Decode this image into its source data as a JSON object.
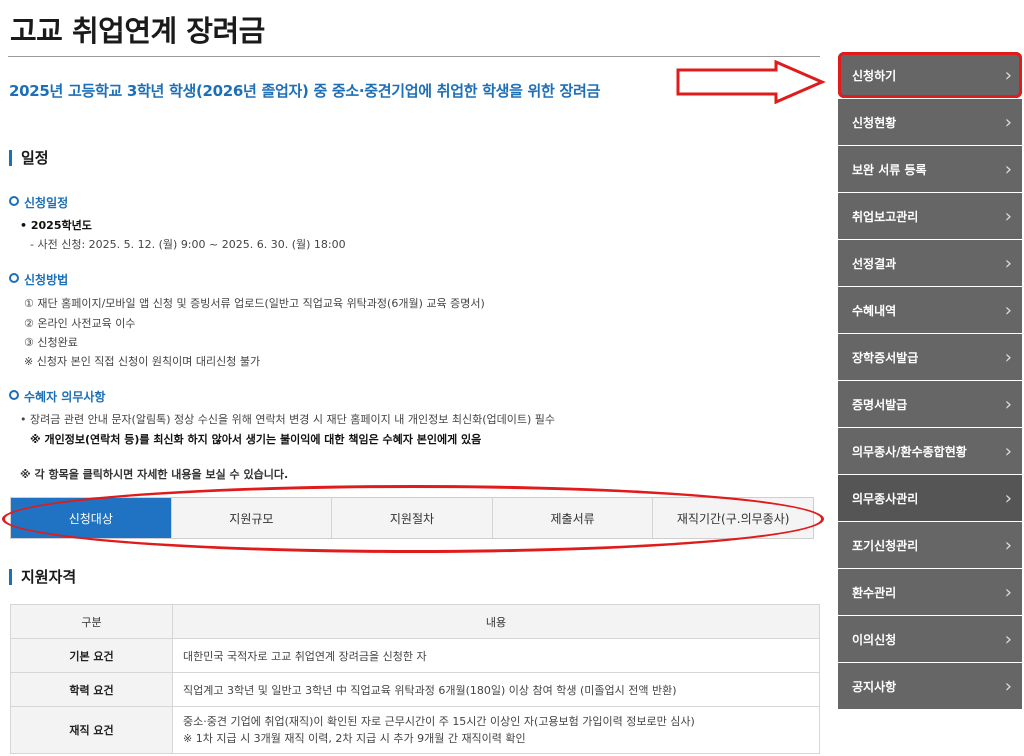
{
  "page": {
    "title": "고교 취업연계 장려금",
    "subtitle": "2025년 고등학교 3학년 학생(2026년 졸업자) 중 중소·중견기업에 취업한 학생을 위한 장려금"
  },
  "schedule": {
    "title": "일정",
    "apply_schedule": {
      "heading": "신청일정",
      "year": "• 2025학년도",
      "detail": "- 사전 신청: 2025. 5. 12. (월) 9:00 ~ 2025. 6. 30. (월) 18:00"
    },
    "apply_method": {
      "heading": "신청방법",
      "steps": [
        "① 재단 홈페이지/모바일 앱 신청 및 증빙서류 업로드(일반고 직업교육 위탁과정(6개월) 교육 증명서)",
        "② 온라인 사전교육 이수",
        "③ 신청완료"
      ],
      "note": "※ 신청자 본인 직접 신청이 원칙이며 대리신청 불가"
    },
    "obligations": {
      "heading": "수혜자 의무사항",
      "item": "• 장려금 관련 안내 문자(알림톡) 정상 수신을 위해 연락처 변경 시 재단 홈페이지 내 개인정보 최신화(업데이트) 필수",
      "warning": "※ 개인정보(연락처 등)를 최신화 하지 않아서 생기는 불이익에 대한 책임은 수혜자 본인에게 있음"
    },
    "click_note": "※ 각 항목을 클릭하시면 자세한 내용을 보실 수 있습니다."
  },
  "tabs": [
    "신청대상",
    "지원규모",
    "지원절차",
    "제출서류",
    "재직기간(구.의무종사)"
  ],
  "eligibility": {
    "title": "지원자격",
    "headers": [
      "구분",
      "내용"
    ],
    "rows": [
      {
        "label": "기본 요건",
        "content": "대한민국 국적자로 고교 취업연계 장려금을 신청한 자"
      },
      {
        "label": "학력 요건",
        "content": "직업계고 3학년 및 일반고 3학년 中 직업교육 위탁과정 6개월(180일) 이상 참여 학생 (미졸업시 전액 반환)"
      },
      {
        "label": "재직 요건",
        "content": "중소·중견 기업에 취업(재직)이 확인된 자로 근무시간이 주 15시간 이상인 자(고용보험 가입이력 정보로만 심사)",
        "content2": "※ 1차 지급 시 3개월 재직 이력, 2차 지급 시 추가 9개월 간 재직이력 확인"
      }
    ]
  },
  "side_menu": [
    "신청하기",
    "신청현황",
    "보완 서류 등록",
    "취업보고관리",
    "선정결과",
    "수혜내역",
    "장학증서발급",
    "증명서발급",
    "의무종사/환수종합현황",
    "의무종사관리",
    "포기신청관리",
    "환수관리",
    "이의신청",
    "공지사항"
  ],
  "colors": {
    "accent_blue": "#1d6fb8",
    "active_tab": "#1f73c2",
    "menu_bg": "#666666",
    "annotation_red": "#e01b1b"
  }
}
